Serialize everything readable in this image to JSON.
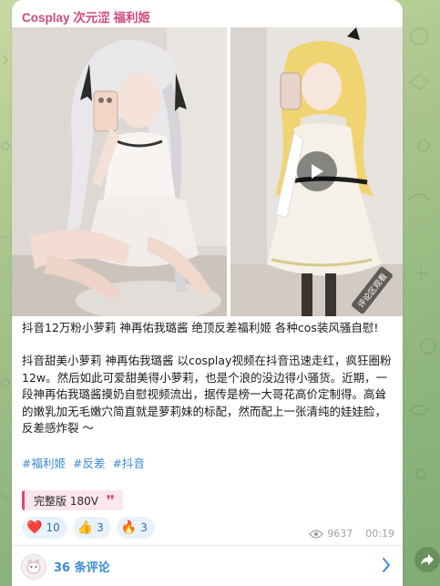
{
  "post": {
    "channel_title": "Cosplay 次元涩 福利姬",
    "video_overlay_text": "评论区观看",
    "title_line": "抖音12万粉小萝莉 神再佑我璐酱 绝顶反差福利姬 各种cos装风骚自慰!",
    "body_line": "抖音甜美小萝莉 神再佑我璐酱 以cosplay视频在抖音迅速走红，疯狂圈粉12w。然后如此可爱甜美得小萝莉，也是个浪的没边得小骚货。近期，一段神再佑我璐酱摸奶自慰视频流出，据传是榜一大哥花高价定制得。高耸的嫩乳加无毛嫩穴简直就是萝莉妹的标配，然而配上一张清纯的娃娃脸，反差感炸裂 ～",
    "tags": [
      "#福利姬",
      "#反差",
      "#抖音"
    ],
    "price_label": "完整版 180V",
    "quote_icon": "quote-icon"
  },
  "reactions": [
    {
      "emoji": "❤️",
      "icon": "heart-icon",
      "count": "10"
    },
    {
      "emoji": "👍",
      "icon": "thumbs-up-icon",
      "count": "3"
    },
    {
      "emoji": "🔥",
      "icon": "fire-icon",
      "count": "3"
    }
  ],
  "meta": {
    "views": "9637",
    "time": "00:19"
  },
  "comments": {
    "label": "36 条评论"
  },
  "colors": {
    "accent_link": "#3a8bd3",
    "channel_title": "#cf4a7c",
    "price_accent": "#d8467d"
  }
}
